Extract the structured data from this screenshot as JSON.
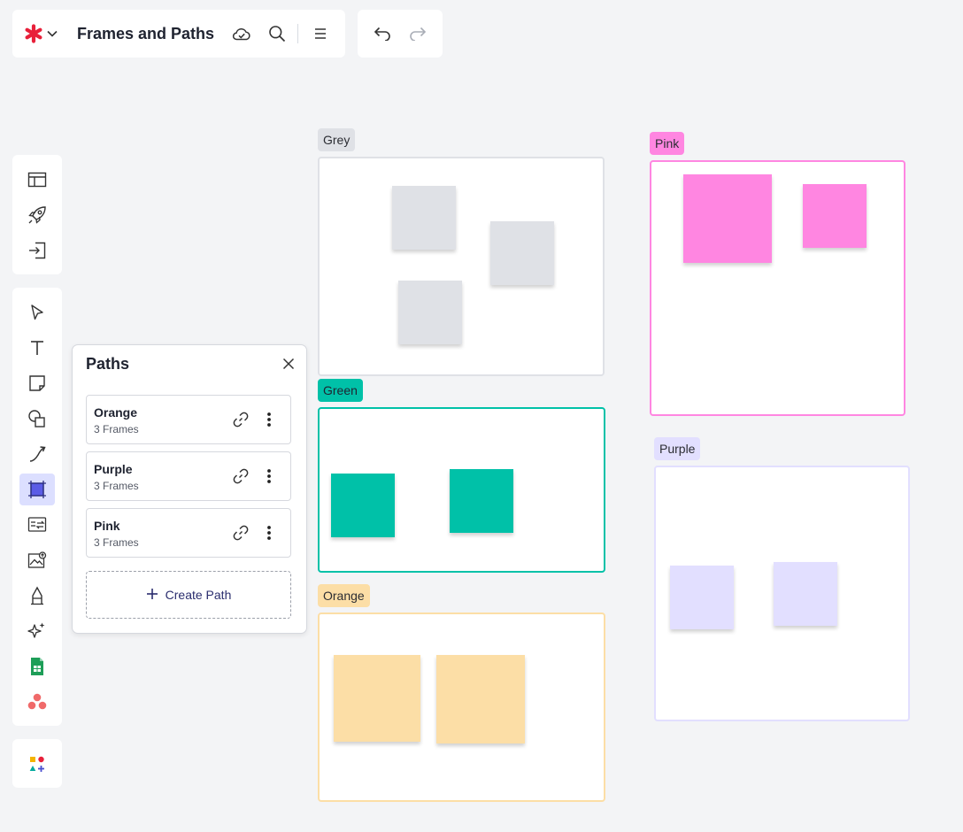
{
  "header": {
    "title": "Frames and Paths",
    "icons": [
      "asterisk-logo-icon",
      "chevron-down-icon",
      "cloud-saved-icon",
      "search-icon",
      "menu-icon"
    ],
    "undo_icons": [
      "undo-icon",
      "redo-icon"
    ]
  },
  "toolbar_top": [
    "template-icon",
    "rocket-icon",
    "import-icon"
  ],
  "toolbar_main": [
    "select-pointer-icon",
    "text-icon",
    "sticky-note-icon",
    "shapes-icon",
    "connector-line-icon",
    "frames-icon",
    "swap-card-icon",
    "image-upload-icon",
    "pen-icon",
    "ai-sparkle-icon",
    "google-sheets-icon",
    "asana-icon"
  ],
  "toolbar_bottom": [
    "add-shapes-icon"
  ],
  "paths_panel": {
    "title": "Paths",
    "items": [
      {
        "name": "Orange",
        "frames": "3 Frames"
      },
      {
        "name": "Purple",
        "frames": "3 Frames"
      },
      {
        "name": "Pink",
        "frames": "3 Frames"
      }
    ],
    "create_label": "Create Path"
  },
  "frames": [
    {
      "label": "Grey",
      "color": "#dfe1e6"
    },
    {
      "label": "Pink",
      "color": "#ff86e1"
    },
    {
      "label": "Green",
      "color": "#00c1a8"
    },
    {
      "label": "Purple",
      "color": "#e2dfff"
    },
    {
      "label": "Orange",
      "color": "#fcdea6"
    }
  ]
}
